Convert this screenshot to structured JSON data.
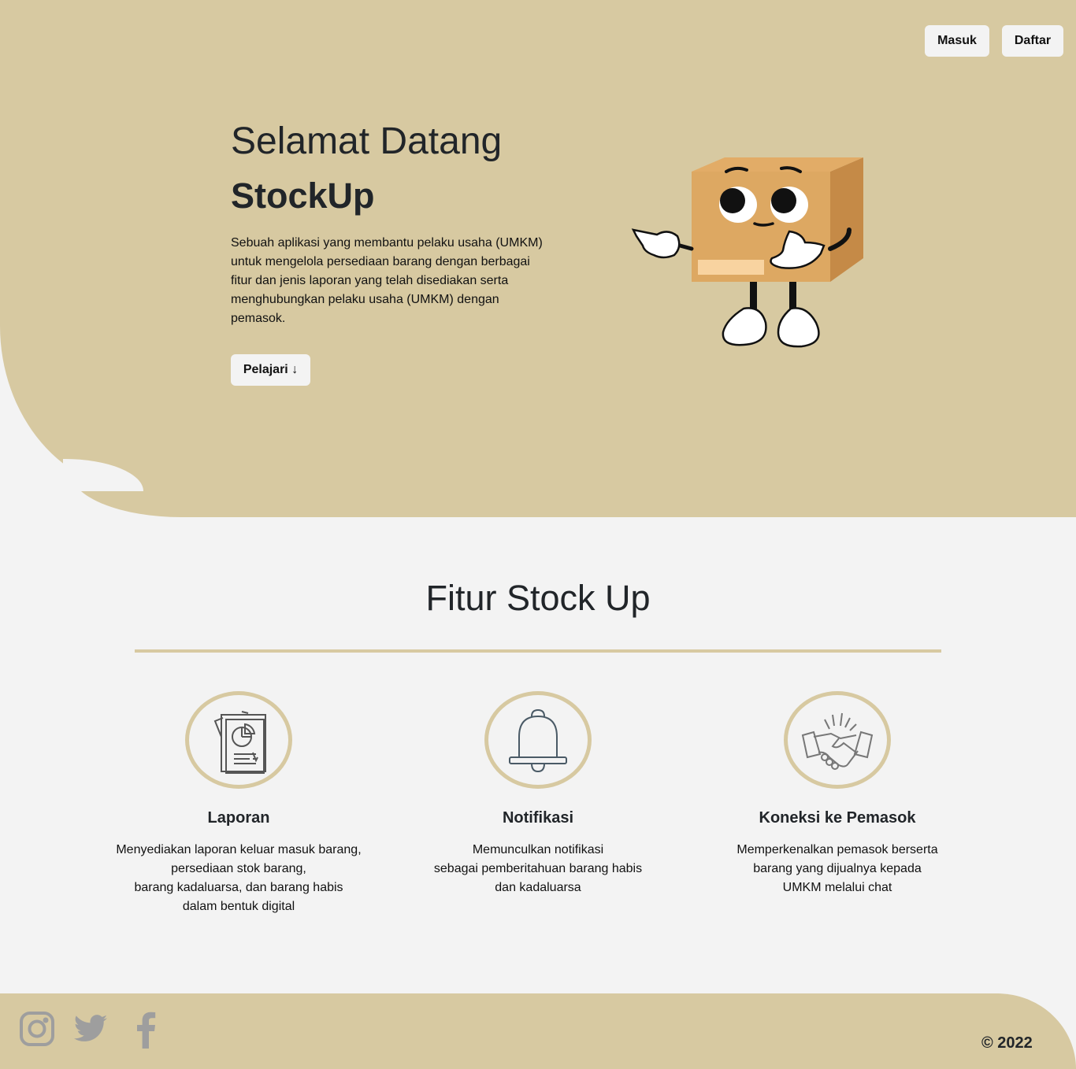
{
  "nav": {
    "login_label": "Masuk",
    "register_label": "Daftar"
  },
  "hero": {
    "title": "Selamat Datang",
    "brand": "StockUp",
    "description": "Sebuah aplikasi yang membantu pelaku usaha (UMKM) untuk mengelola persediaan barang dengan berbagai fitur dan jenis laporan yang telah disediakan serta menghubungkan pelaku usaha (UMKM) dengan pemasok.",
    "cta_label": "Pelajari ↓",
    "illustration": "box-mascot"
  },
  "features": {
    "title": "Fitur Stock Up",
    "items": [
      {
        "icon": "report-icon",
        "title": "Laporan",
        "text": "Menyediakan laporan keluar masuk barang,\npersediaan stok barang,\nbarang kadaluarsa, dan barang habis\ndalam bentuk digital"
      },
      {
        "icon": "bell-icon",
        "title": "Notifikasi",
        "text": "Memunculkan notifikasi\nsebagai pemberitahuan barang habis\ndan kadaluarsa"
      },
      {
        "icon": "handshake-icon",
        "title": "Koneksi ke Pemasok",
        "text": "Memperkenalkan pemasok berserta\nbarang yang dijualnya kepada\nUMKM melalui chat"
      }
    ]
  },
  "footer": {
    "social": [
      "instagram-icon",
      "twitter-icon",
      "facebook-icon"
    ],
    "copyright": "© 2022"
  },
  "colors": {
    "accent": "#d7c9a1",
    "background": "#f3f3f3",
    "text": "#212529",
    "icon_gray": "#9e9e9e"
  }
}
